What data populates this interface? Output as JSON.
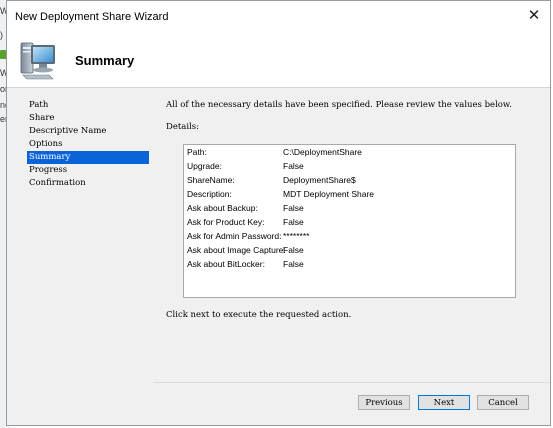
{
  "background": {
    "fragments": [
      "W",
      ")",
      "W",
      "or",
      "ne",
      "en"
    ]
  },
  "window": {
    "title": "New Deployment Share Wizard",
    "close_glyph": "✕"
  },
  "header": {
    "title": "Summary",
    "icon": "computer-icon"
  },
  "nav": {
    "items": [
      {
        "label": "Path",
        "selected": false
      },
      {
        "label": "Share",
        "selected": false
      },
      {
        "label": "Descriptive Name",
        "selected": false
      },
      {
        "label": "Options",
        "selected": false
      },
      {
        "label": "Summary",
        "selected": true
      },
      {
        "label": "Progress",
        "selected": false
      },
      {
        "label": "Confirmation",
        "selected": false
      }
    ],
    "selected_color": "#0a64d8"
  },
  "content": {
    "intro": "All of the necessary details have been specified.  Please review the values below.",
    "details_label": "Details:",
    "details": [
      {
        "key": "Path:",
        "value": "C:\\DeploymentShare"
      },
      {
        "key": "Upgrade:",
        "value": "False"
      },
      {
        "key": "ShareName:",
        "value": "DeploymentShare$"
      },
      {
        "key": "Description:",
        "value": "MDT Deployment Share"
      },
      {
        "key": "Ask about Backup:",
        "value": "False"
      },
      {
        "key": "Ask for Product Key:",
        "value": "False"
      },
      {
        "key": "Ask for Admin Password:",
        "value": "********"
      },
      {
        "key": "Ask about Image Capture:",
        "value": "False"
      },
      {
        "key": "Ask about BitLocker:",
        "value": "False"
      }
    ],
    "footer_note": "Click next to execute the requested action."
  },
  "buttons": {
    "previous": "Previous",
    "next": "Next",
    "cancel": "Cancel"
  }
}
